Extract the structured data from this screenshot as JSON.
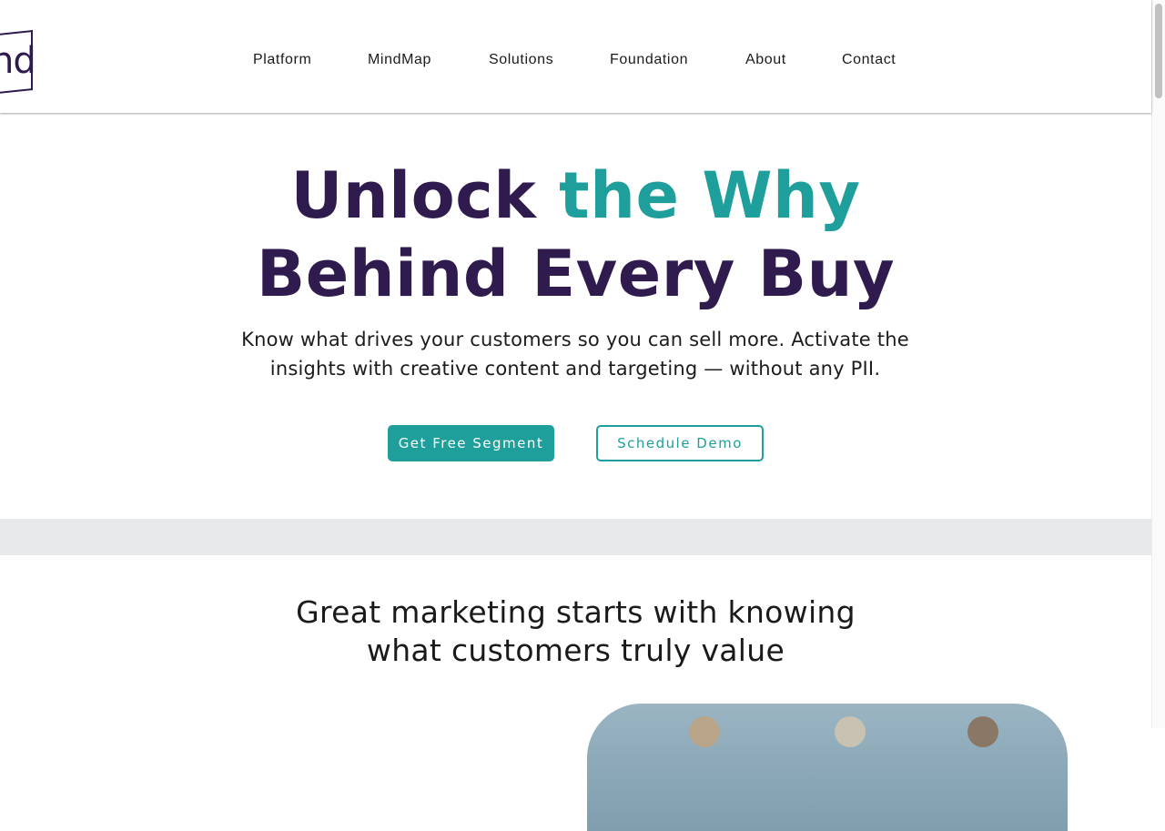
{
  "header": {
    "logo_letters": "nd",
    "nav": [
      {
        "label": "Platform"
      },
      {
        "label": "MindMap"
      },
      {
        "label": "Solutions"
      },
      {
        "label": "Foundation"
      },
      {
        "label": "About"
      },
      {
        "label": "Contact"
      }
    ]
  },
  "hero": {
    "title_part1": "Unlock ",
    "title_accent": "the Why",
    "title_line2": "Behind Every Buy",
    "subtitle_line1": "Know what drives your customers so you can sell more. Activate the",
    "subtitle_line2": "insights with creative content and targeting — without any PII.",
    "primary_button": "Get Free Segment",
    "secondary_button": "Schedule Demo"
  },
  "section": {
    "title_line1": "Great marketing starts with knowing",
    "title_line2": "what customers truly value"
  },
  "colors": {
    "brand_purple": "#301b4f",
    "accent_teal": "#1f9f9c",
    "band_gray": "#e8e9ea"
  }
}
